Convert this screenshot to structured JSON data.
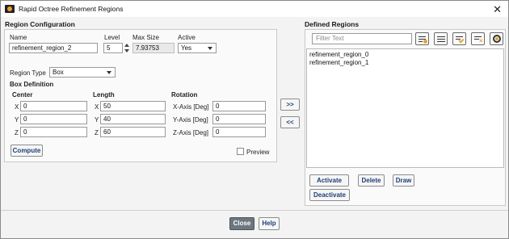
{
  "window": {
    "title": "Rapid Octree Refinement Regions",
    "close_glyph": "✕"
  },
  "config": {
    "section_title": "Region Configuration",
    "name_label": "Name",
    "name_value": "refinement_region_2",
    "level_label": "Level",
    "level_value": "5",
    "maxsize_label": "Max Size",
    "maxsize_value": "7.93753",
    "active_label": "Active",
    "active_value": "Yes",
    "region_type_label": "Region Type",
    "region_type_value": "Box",
    "box_def_label": "Box Definition",
    "center_label": "Center",
    "length_label": "Length",
    "rotation_label": "Rotation",
    "center": {
      "x_label": "X",
      "x": "0",
      "y_label": "Y",
      "y": "0",
      "z_label": "Z",
      "z": "0"
    },
    "length": {
      "x_label": "X",
      "x": "50",
      "y_label": "Y",
      "y": "40",
      "z_label": "Z",
      "z": "60"
    },
    "rotation": {
      "x_label": "X-Axis [Deg]",
      "x": "0",
      "y_label": "Y-Axis [Deg]",
      "y": "0",
      "z_label": "Z-Axis [Deg]",
      "z": "0"
    },
    "compute_label": "Compute",
    "preview_label": "Preview",
    "preview_checked": false
  },
  "transfer": {
    "add_label": ">>",
    "remove_label": "<<"
  },
  "defined": {
    "section_title": "Defined Regions",
    "filter_placeholder": "Filter Text",
    "toolbar_icons": [
      "filter-settings-icon",
      "select-all-icon",
      "check-list-icon",
      "clear-list-icon",
      "target-icon"
    ],
    "items": [
      "refinement_region_0",
      "refinement_region_1"
    ],
    "activate_label": "Activate",
    "delete_label": "Delete",
    "draw_label": "Draw",
    "deactivate_label": "Deactivate"
  },
  "footer": {
    "close_label": "Close",
    "help_label": "Help"
  }
}
